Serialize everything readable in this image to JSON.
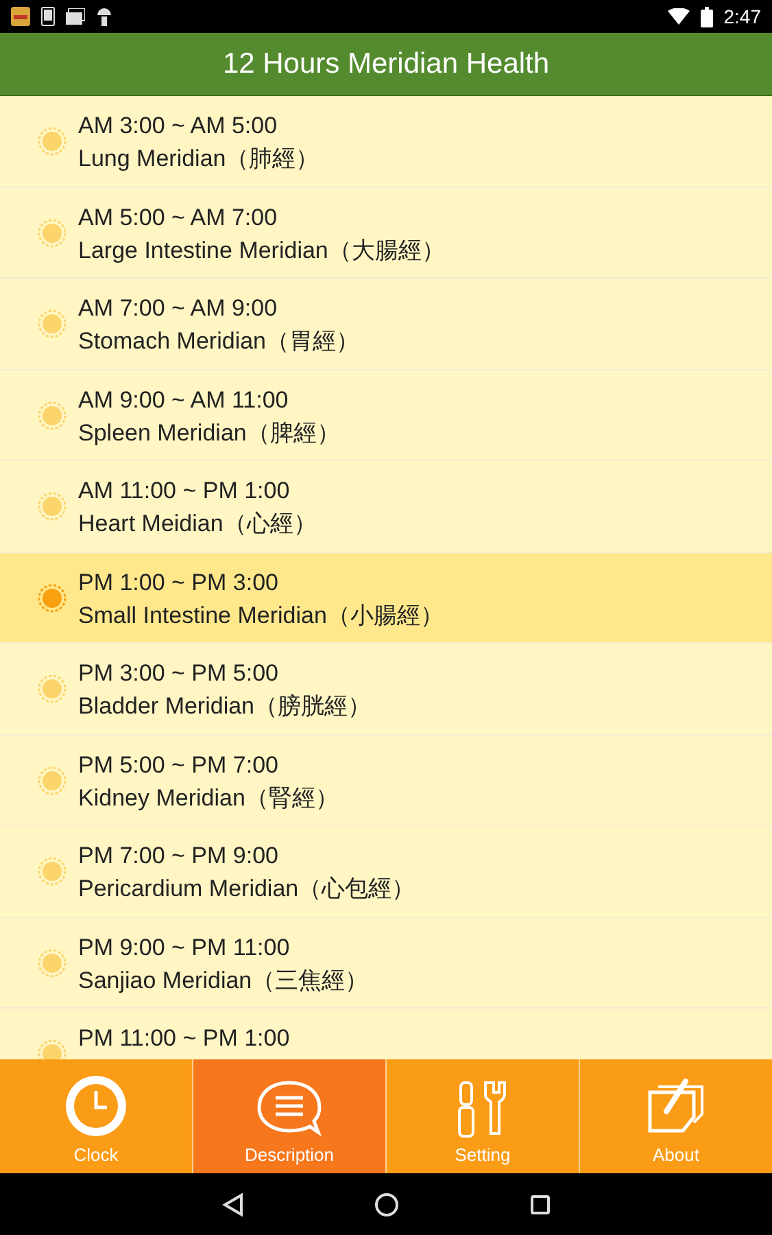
{
  "status_bar": {
    "time": "2:47"
  },
  "title": "12 Hours Meridian Health",
  "meridians": [
    {
      "time": "AM 3:00 ~ AM 5:00",
      "name": "Lung Meridian（肺經）",
      "selected": false
    },
    {
      "time": "AM 5:00 ~ AM 7:00",
      "name": "Large Intestine Meridian（大腸經）",
      "selected": false
    },
    {
      "time": "AM 7:00 ~ AM 9:00",
      "name": "Stomach Meridian（胃經）",
      "selected": false
    },
    {
      "time": "AM 9:00 ~ AM 11:00",
      "name": "Spleen Meridian（脾經）",
      "selected": false
    },
    {
      "time": "AM 11:00 ~ PM 1:00",
      "name": "Heart Meidian（心經）",
      "selected": false
    },
    {
      "time": "PM 1:00 ~ PM 3:00",
      "name": "Small Intestine Meridian（小腸經）",
      "selected": true
    },
    {
      "time": "PM 3:00 ~ PM 5:00",
      "name": "Bladder Meridian（膀胱經）",
      "selected": false
    },
    {
      "time": "PM 5:00 ~ PM 7:00",
      "name": "Kidney Meridian（腎經）",
      "selected": false
    },
    {
      "time": "PM 7:00 ~ PM 9:00",
      "name": "Pericardium Meridian（心包經）",
      "selected": false
    },
    {
      "time": "PM 9:00 ~ PM 11:00",
      "name": "Sanjiao Meridian（三焦經）",
      "selected": false
    },
    {
      "time": "PM 11:00 ~ PM 1:00",
      "selected": false
    }
  ],
  "tabs": [
    {
      "label": "Clock",
      "kind": "clock",
      "selected": false
    },
    {
      "label": "Description",
      "kind": "description",
      "selected": true
    },
    {
      "label": "Setting",
      "kind": "setting",
      "selected": false
    },
    {
      "label": "About",
      "kind": "about",
      "selected": false
    }
  ]
}
